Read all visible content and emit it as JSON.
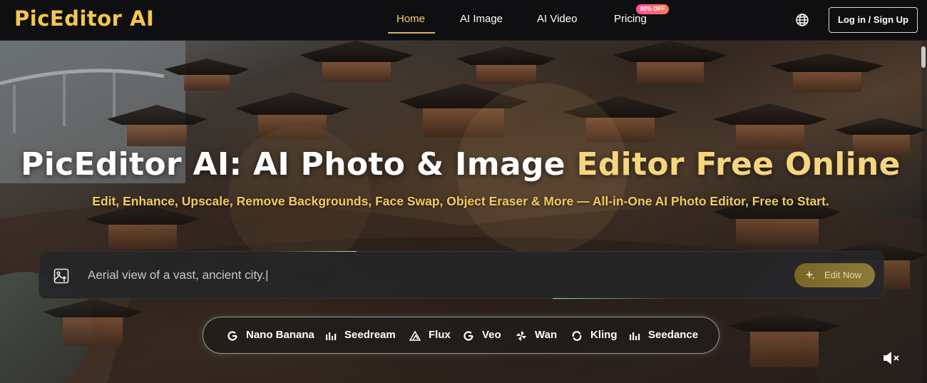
{
  "nav": {
    "logo": "PicEditor AI",
    "links": [
      {
        "label": "Home",
        "active": true
      },
      {
        "label": "AI Image",
        "active": false
      },
      {
        "label": "AI Video",
        "active": false
      },
      {
        "label": "Pricing",
        "active": false
      }
    ],
    "pricing_badge": "80% OFF",
    "globe_icon": "globe-icon",
    "login_label": "Log in / Sign Up"
  },
  "hero": {
    "headline_white": "PicEditor AI: AI Photo & Image ",
    "headline_gold": "Editor Free Online",
    "subheadline": "Edit, Enhance, Upscale, Remove Backgrounds, Face Swap, Object Eraser & More — All-in-One AI Photo Editor, Free to Start.",
    "prompt": {
      "value": "Aerial view of a vast, ancient city.|",
      "upload_icon": "image-upload-icon",
      "button_label": "Edit Now",
      "button_icon": "sparkle-icon"
    },
    "models": [
      {
        "name": "Nano Banana",
        "icon": "google-g-icon"
      },
      {
        "name": "Seedream",
        "icon": "bars-icon"
      },
      {
        "name": "Flux",
        "icon": "triangle-icon"
      },
      {
        "name": "Veo",
        "icon": "google-g-icon"
      },
      {
        "name": "Wan",
        "icon": "pinwheel-icon"
      },
      {
        "name": "Kling",
        "icon": "swirl-icon"
      },
      {
        "name": "Seedance",
        "icon": "bars-icon"
      }
    ],
    "mute_icon": "speaker-muted-icon"
  },
  "colors": {
    "brand_gold": "#f4c64c",
    "nav_bg": "#0f0f11",
    "button_gold": "#8e7a3a"
  }
}
